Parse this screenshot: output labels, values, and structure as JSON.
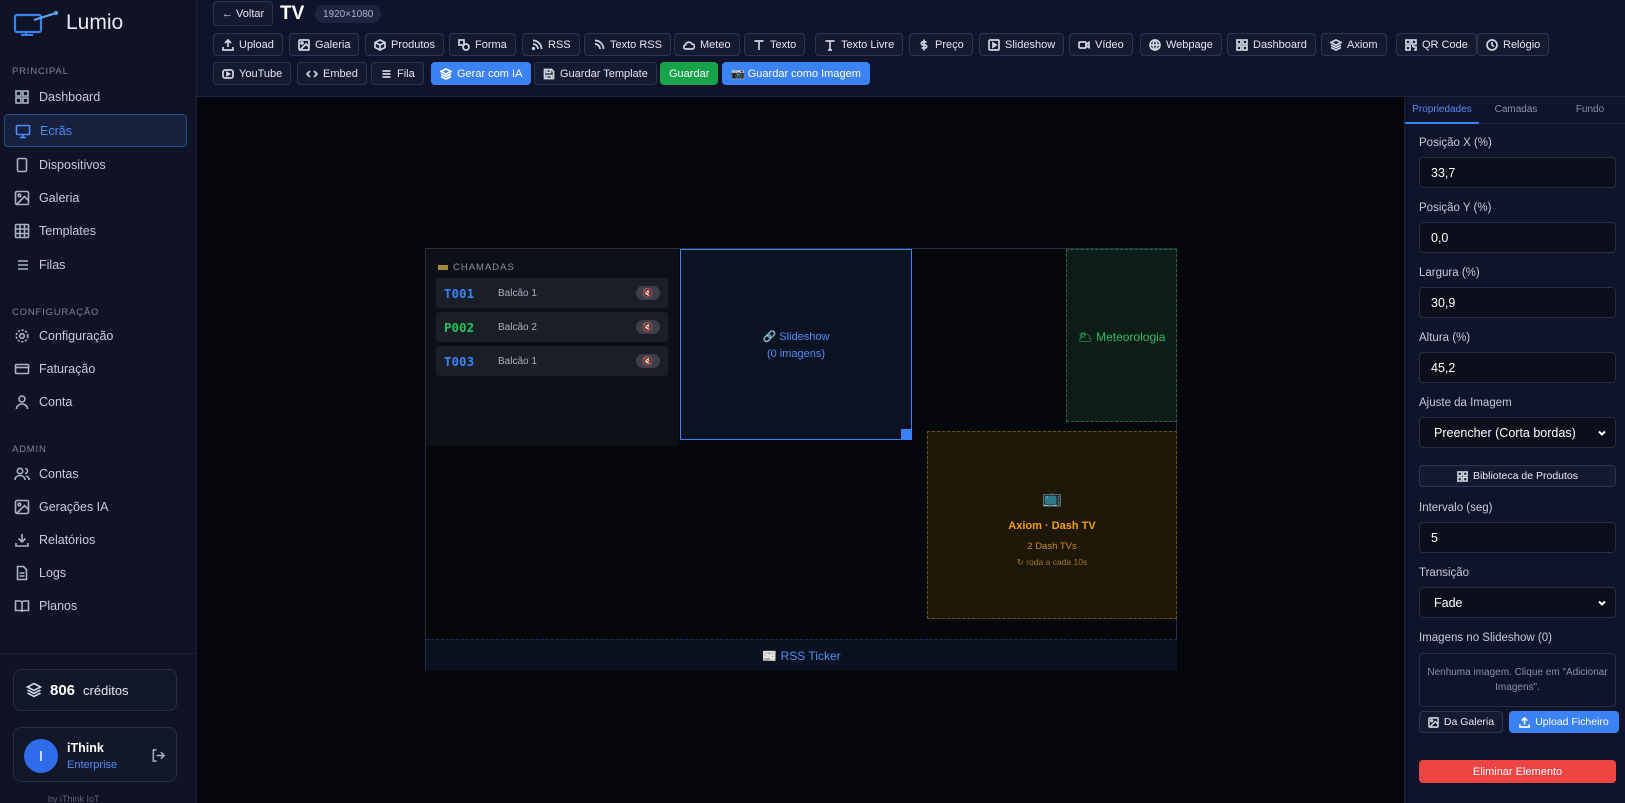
{
  "app": {
    "name": "Lumio",
    "byline": "by iThink IoT"
  },
  "sidebar": {
    "sections": [
      {
        "title": "PRINCIPAL",
        "items": [
          {
            "label": "Dashboard",
            "icon": "grid-icon"
          },
          {
            "label": "Ecrãs",
            "icon": "monitor-icon",
            "active": true
          },
          {
            "label": "Dispositivos",
            "icon": "tablet-icon"
          },
          {
            "label": "Galeria",
            "icon": "image-icon"
          },
          {
            "label": "Templates",
            "icon": "layout-icon"
          },
          {
            "label": "Filas",
            "icon": "list-icon"
          }
        ]
      },
      {
        "title": "CONFIGURAÇÃO",
        "items": [
          {
            "label": "Configuração",
            "icon": "gear-icon"
          },
          {
            "label": "Faturação",
            "icon": "card-icon"
          },
          {
            "label": "Conta",
            "icon": "user-icon"
          }
        ]
      },
      {
        "title": "ADMIN",
        "items": [
          {
            "label": "Contas",
            "icon": "users-icon"
          },
          {
            "label": "Gerações IA",
            "icon": "image-icon"
          },
          {
            "label": "Relatórios",
            "icon": "download-icon"
          },
          {
            "label": "Logs",
            "icon": "file-icon"
          },
          {
            "label": "Planos",
            "icon": "book-icon"
          }
        ]
      }
    ],
    "credits": {
      "value": "806",
      "label": "créditos"
    },
    "user": {
      "initial": "I",
      "name": "iThink",
      "plan": "Enterprise"
    }
  },
  "header": {
    "back_label": "← Voltar",
    "title": "TV",
    "resolution": "1920×1080",
    "toolbar_row1": [
      {
        "label": "Upload",
        "icon": "upload-icon"
      },
      {
        "label": "Galeria",
        "icon": "image-icon"
      },
      {
        "label": "Produtos",
        "icon": "box-icon"
      },
      {
        "label": "Forma",
        "icon": "shapes-icon"
      },
      {
        "label": "RSS",
        "icon": "rss-icon"
      },
      {
        "label": "Texto RSS",
        "icon": "rss-text-icon"
      },
      {
        "label": "Meteo",
        "icon": "weather-icon"
      },
      {
        "label": "Texto",
        "icon": "text-icon"
      },
      {
        "label": "Texto Livre",
        "icon": "text-free-icon"
      },
      {
        "label": "Preço",
        "icon": "dollar-icon"
      },
      {
        "label": "Slideshow",
        "icon": "play-icon"
      },
      {
        "label": "Vídeo",
        "icon": "video-icon"
      },
      {
        "label": "Webpage",
        "icon": "globe-icon"
      },
      {
        "label": "Dashboard",
        "icon": "grid-icon"
      },
      {
        "label": "Axiom",
        "icon": "layers-icon"
      },
      {
        "label": "QR Code",
        "icon": "qr-icon"
      },
      {
        "label": "Relógio",
        "icon": "clock-icon"
      }
    ],
    "toolbar_row2": [
      {
        "label": "YouTube",
        "icon": "youtube-icon"
      },
      {
        "label": "Embed",
        "icon": "code-icon"
      },
      {
        "label": "Fila",
        "icon": "list-icon"
      },
      {
        "label": "Gerar com IA",
        "icon": "layers-icon",
        "style": "blue"
      },
      {
        "label": "Guardar Template",
        "icon": "save-icon"
      },
      {
        "label": "Guardar",
        "style": "green"
      },
      {
        "label": "📷 Guardar como Imagem",
        "style": "blue"
      }
    ]
  },
  "canvas": {
    "calls": {
      "header": "CHAMADAS",
      "items": [
        {
          "code": "T001",
          "desk": "Balcão 1",
          "color": "#3b82f6"
        },
        {
          "code": "P002",
          "desk": "Balcão 2",
          "color": "#22c55e"
        },
        {
          "code": "T003",
          "desk": "Balcão 1",
          "color": "#3b82f6"
        }
      ],
      "speaker_icon": "🔇"
    },
    "slideshow": {
      "line1": "🔗 Slideshow",
      "line2": "(0 imagens)"
    },
    "meteo": {
      "label": "🌥 Meteorologia"
    },
    "axiom": {
      "icon": "📺",
      "title": "Axiom · Dash TV",
      "subtitle": "2 Dash TVs",
      "rotation": "↻ roda a cada 10s"
    },
    "rss": {
      "label": "📰 RSS Ticker"
    }
  },
  "panel": {
    "tabs": [
      "Propriedades",
      "Camadas",
      "Fundo"
    ],
    "fields": {
      "pos_x": {
        "label": "Posição X (%)",
        "value": "33,7"
      },
      "pos_y": {
        "label": "Posição Y (%)",
        "value": "0,0"
      },
      "width": {
        "label": "Largura (%)",
        "value": "30,9"
      },
      "height": {
        "label": "Altura (%)",
        "value": "45,2"
      },
      "fit": {
        "label": "Ajuste da Imagem",
        "value": "Preencher (Corta bordas)"
      },
      "interval": {
        "label": "Intervalo (seg)",
        "value": "5"
      },
      "transition": {
        "label": "Transição",
        "value": "Fade"
      }
    },
    "product_library": "Biblioteca de Produtos",
    "images_label": "Imagens no Slideshow (0)",
    "images_empty": "Nenhuma imagem. Clique em \"Adicionar Imagens\".",
    "from_gallery": "Da Galeria",
    "upload_file": "Upload Ficheiro",
    "delete": "Eliminar Elemento"
  }
}
